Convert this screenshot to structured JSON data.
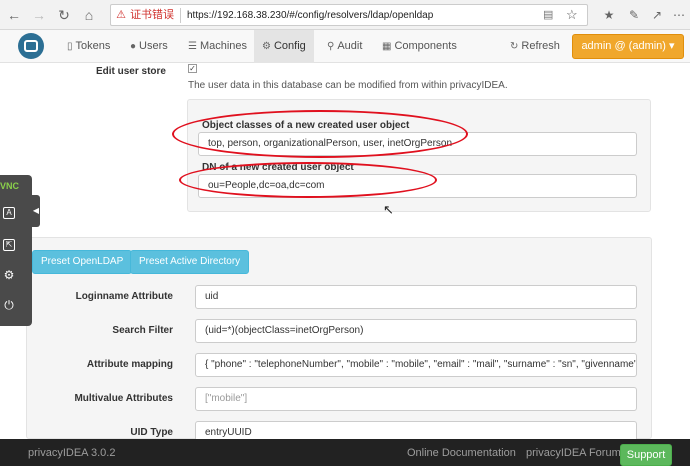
{
  "browser": {
    "cert_warning": "证书错误",
    "url": "https://192.168.38.230/#/config/resolvers/ldap/openldap",
    "back_icon": "arrow-left-icon",
    "forward_icon": "arrow-right-icon",
    "refresh_icon": "refresh-icon",
    "home_icon": "home-icon"
  },
  "navbar": {
    "items": [
      {
        "label": "Tokens",
        "icon": "mobile-icon"
      },
      {
        "label": "Users",
        "icon": "user-icon"
      },
      {
        "label": "Machines",
        "icon": "list-icon"
      },
      {
        "label": "Config",
        "icon": "gear-icon",
        "active": true
      },
      {
        "label": "Audit",
        "icon": "search-icon"
      },
      {
        "label": "Components",
        "icon": "components-icon"
      }
    ],
    "refresh_label": "Refresh",
    "admin_label": "admin @ (admin)"
  },
  "form": {
    "edit_user_store_label": "Edit user store",
    "edit_user_store_help": "The user data in this database can be modified from within privacyIDEA.",
    "object_classes_label": "Object classes of a new created user object",
    "object_classes_value": "top, person, organizationalPerson, user, inetOrgPerson",
    "dn_label": "DN of a new created user object",
    "dn_value": "ou=People,dc=oa,dc=com",
    "preset_openldap": "Preset OpenLDAP",
    "preset_ad": "Preset Active Directory",
    "loginname_label": "Loginname Attribute",
    "loginname_value": "uid",
    "search_filter_label": "Search Filter",
    "search_filter_value": "(uid=*)(objectClass=inetOrgPerson)",
    "attr_mapping_label": "Attribute mapping",
    "attr_mapping_value": "{ \"phone\" : \"telephoneNumber\", \"mobile\" : \"mobile\", \"email\" : \"mail\", \"surname\" : \"sn\", \"givenname\"",
    "multivalue_label": "Multivalue Attributes",
    "multivalue_placeholder": "[\"mobile\"]",
    "uid_type_label": "UID Type",
    "uid_type_value": "entryUUID"
  },
  "vnc": {
    "logo": "VNC"
  },
  "footer": {
    "version": "privacyIDEA 3.0.2",
    "online_docs": "Online Documentation",
    "forum": "privacyIDEA Forum",
    "support": "Support"
  },
  "colors": {
    "admin_button": "#f0a72c",
    "preset_button": "#5bc0de",
    "support_button": "#5cb85c",
    "annotation_red": "#e0101e"
  }
}
